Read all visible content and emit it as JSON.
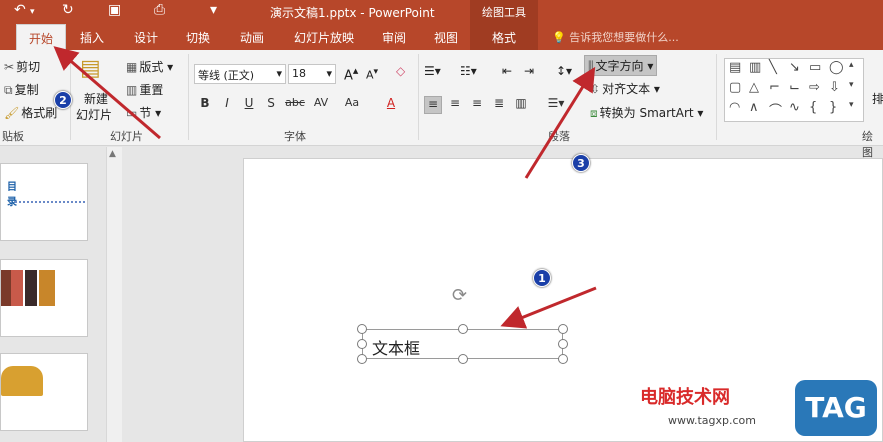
{
  "window": {
    "title": "演示文稿1.pptx - PowerPoint",
    "context_label": "绘图工具"
  },
  "tabs": [
    "开始",
    "插入",
    "设计",
    "切换",
    "动画",
    "幻灯片放映",
    "审阅",
    "视图",
    "格式"
  ],
  "tell_me": "告诉我您想要做什么...",
  "clipboard": {
    "cut": "剪切",
    "copy": "复制",
    "format_painter": "格式刷",
    "label": "贴板"
  },
  "slides_group": {
    "new_slide_line1": "新建",
    "new_slide_line2": "幻灯片",
    "layout": "版式",
    "reset": "重置",
    "section": "节",
    "label": "幻灯片"
  },
  "font_group": {
    "font_name": "等线 (正文)",
    "font_size": "18",
    "label": "字体",
    "bold": "B",
    "italic": "I",
    "underline": "U",
    "shadow": "S",
    "strike": "abc",
    "spacing": "AV",
    "case": "Aa",
    "color": "A",
    "grow": "A",
    "shrink": "A"
  },
  "paragraph_group": {
    "text_direction": "文字方向",
    "align_text": "对齐文本",
    "smartart": "转换为 SmartArt",
    "label": "段落"
  },
  "drawing_group": {
    "label": "绘图",
    "arrange_partial": "排"
  },
  "thumbnails": {
    "slide1_title": "目 录"
  },
  "slide": {
    "textbox_text": "文本框"
  },
  "markers": [
    "1",
    "2",
    "3"
  ],
  "watermark": {
    "site": "电脑技术网",
    "url": "www.tagxp.com",
    "tag": "TAG"
  },
  "colors": {
    "accent": "#b7472a",
    "marker": "#1a3fa8",
    "arrow": "#c0282d"
  }
}
